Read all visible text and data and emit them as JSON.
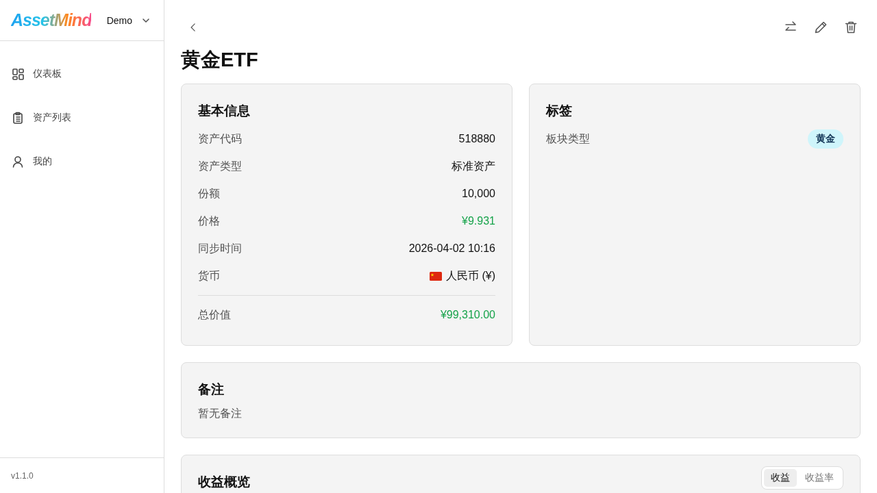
{
  "sidebar": {
    "logo": "AssetMind",
    "account": "Demo",
    "items": [
      {
        "label": "仪表板",
        "selected": false
      },
      {
        "label": "资产列表",
        "selected": false
      },
      {
        "label": "我的",
        "selected": false
      }
    ],
    "version": "v1.1.0"
  },
  "title": "黄金ETF",
  "basic_info": {
    "heading": "基本信息",
    "rows": [
      {
        "label": "资产代码",
        "value": "518880",
        "kind": "plain"
      },
      {
        "label": "资产类型",
        "value": "标准资产",
        "kind": "plain"
      },
      {
        "label": "份额",
        "value": "10,000",
        "kind": "plain"
      },
      {
        "label": "价格",
        "value": "¥9.931",
        "kind": "money"
      },
      {
        "label": "同步时间",
        "value": "2026-04-02 10:16",
        "kind": "plain"
      },
      {
        "label": "货币",
        "value": "人民币 (¥)",
        "kind": "currency"
      }
    ],
    "total": {
      "label": "总价值",
      "value": "¥99,310.00"
    }
  },
  "tags": {
    "heading": "标签",
    "rows": [
      {
        "label": "板块类型",
        "tag": "黄金",
        "color": "#cff5fb"
      }
    ]
  },
  "notes": {
    "heading": "备注",
    "text": "暂无备注"
  },
  "overview": {
    "heading": "收益概览",
    "tabs": [
      {
        "label": "收益",
        "selected": true
      },
      {
        "label": "收益率",
        "selected": false
      }
    ]
  }
}
